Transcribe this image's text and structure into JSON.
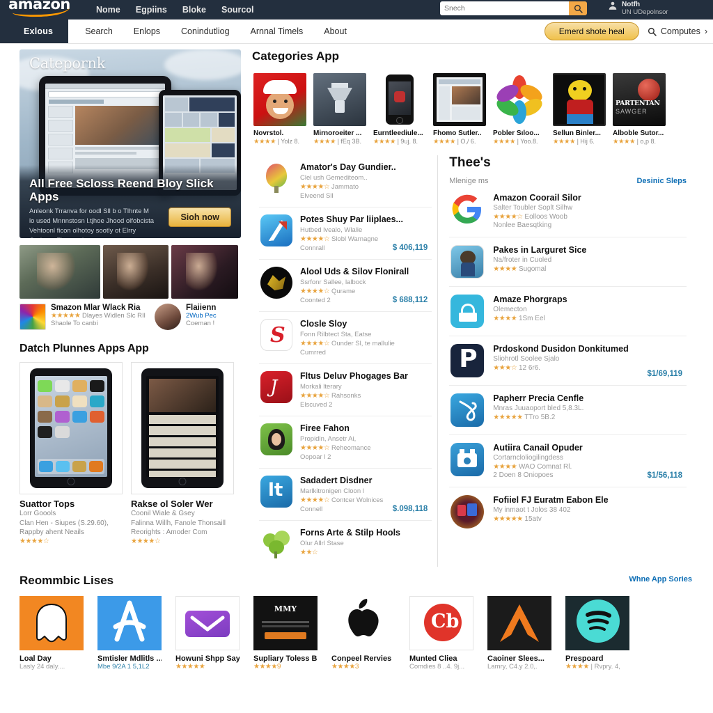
{
  "topnav": {
    "logo": "amazon",
    "links": [
      "Nome",
      "Egpiins",
      "Bloke",
      "Sourcol"
    ],
    "search_placeholder": "Snech",
    "search_icon": "search-icon",
    "account_line1": "Notfh",
    "account_line2": "UN UDepolnsor"
  },
  "subnav": {
    "brand": "Exlous",
    "links": [
      "Search",
      "Enlops",
      "Conindutliog",
      "Arnnal Timels",
      "About"
    ],
    "cta": "Emerd shote heal",
    "search_label": "Computes",
    "chevron": "›"
  },
  "hero": {
    "logo": "Catepornk",
    "title": "All Free Scloss Reend Bloy Slick Apps",
    "subtitle": "Anleonk Trranva for oodl Sll b o Tlhnte M lo used Mnnnstosn l.tjhoe Jhood olfobcista Vehtoonl ficon olhotoy sootly ot Elrry Gurboes Floceernl.",
    "cta": "Sioh now"
  },
  "left": {
    "mini_items": [
      {
        "title": "Smazon Mlar Wlack Ria",
        "line1": "Dlayes Widlen Slc RIl",
        "line2": "Shaole To canbi",
        "stars": "★★★★★"
      },
      {
        "title": "Flaiienn",
        "line1": "2Wub Pec",
        "line2": "Coeman !",
        "stars": ""
      }
    ],
    "section_title": "Datch Plunnes Apps App",
    "tablets": [
      {
        "title": "Suattor Tops",
        "sub1": "Lorr Goools",
        "sub2": "Clan Hen - Siupes (S.29.60), Rappby ahent Neails",
        "stars": "★★★★☆"
      },
      {
        "title": "Rakse ol Soler Wer",
        "sub1": "Coonil Wiale & Gsey",
        "sub2": "Falinna Willh, Fanole Thonsaill Reorights : Amoder Com",
        "stars": "★★★★☆"
      }
    ]
  },
  "categories": {
    "title": "Categories App",
    "apps": [
      {
        "label": "Novrstol.",
        "stars": "★★★★",
        "rate": "| Yolz 8.",
        "icon": "santa-character-icon"
      },
      {
        "label": "Mirnoroeiter ...",
        "stars": "★★★★",
        "rate": "| fEq 3B.",
        "icon": "lantern-icon"
      },
      {
        "label": "Eurntleediule...",
        "stars": "★★★★",
        "rate": "| 9uj. 8.",
        "icon": "phone-icon"
      },
      {
        "label": "Fhomo Sutler..",
        "stars": "★★★★",
        "rate": "| O,/ 6.",
        "icon": "tablet-screen-icon"
      },
      {
        "label": "Pobler Sıloo...",
        "stars": "★★★★",
        "rate": "| Yoo.8.",
        "icon": "flower-pinwheel-icon"
      },
      {
        "label": "Sellun Binler...",
        "stars": "★★★★",
        "rate": "| Hij 6.",
        "icon": "cartoon-face-icon"
      },
      {
        "label": "Alboble Sutor...",
        "stars": "★★★★",
        "rate": "| o,p 8.",
        "icon": "movie-poster-icon"
      }
    ]
  },
  "mid_list": [
    {
      "title": "Amator's Day Gundier..",
      "sub": "Clel ush Gemediteom..",
      "stars": "★★★★☆",
      "rate": "Jammato",
      "meta": "Elveend Sll",
      "price": "",
      "icon": "balloon-icon"
    },
    {
      "title": "Potes Shuy Par liiplaes...",
      "sub": "Hutbed lvealo, Wlalie",
      "stars": "★★★★☆",
      "rate": "Slobl Warnagne",
      "meta": "Connrall",
      "price": "$ 406,119",
      "icon": "compass-pen-icon"
    },
    {
      "title": "Alool Uds & Silov Flonirall",
      "sub": "Ssrfonr Sallee, lalbock",
      "stars": "★★★★☆",
      "rate": "Qurame",
      "meta": "Coonted 2",
      "price": "$ 688,112",
      "icon": "dragon-icon"
    },
    {
      "title": "Closle Sloy",
      "sub": "Fonn Rilbtect Sta, Eatse",
      "stars": "★★★★☆",
      "rate": "Ounder Sl, te mallulie",
      "meta": "Cumrred",
      "price": "",
      "icon": "red-s-icon"
    },
    {
      "title": "Fltus Deluv Phogages Bar",
      "sub": "Morkali lterary",
      "stars": "★★★★☆",
      "rate": "Rahsonks",
      "meta": "Elscuved 2",
      "price": "",
      "icon": "music-note-icon"
    },
    {
      "title": "Firee Fahon",
      "sub": "Propidln, Ansetr Ai,",
      "stars": "★★★★☆",
      "rate": "Reheomance",
      "meta": "Oopoar l 2",
      "price": "",
      "icon": "avatar-green-icon"
    },
    {
      "title": "Sadadert Disdner",
      "sub": "Marlkitronigen Cloon l",
      "stars": "★★★★☆",
      "rate": "Contcer Wolnices",
      "meta": "Connell",
      "price": "$.098,118",
      "icon": "blue-it-icon"
    },
    {
      "title": "Forns Arte & Stilp Hools",
      "sub": "Olur Allrl Stase",
      "stars": "★★☆",
      "rate": "",
      "meta": "",
      "price": "",
      "icon": "trees-icon"
    }
  ],
  "right": {
    "title": "Thee's",
    "subtitle": "Mlenige ms",
    "link": "Desinic Sleps",
    "items": [
      {
        "title": "Amazon Coorail Silor",
        "sub": "Salter Toubler Soplt Silhw",
        "stars": "★★★★☆",
        "rate": "Eolloos Woob",
        "meta": "Nonlee Baesqtking",
        "price": "",
        "icon": "google-g-icon"
      },
      {
        "title": "Pakes in Larguret Sice",
        "sub": "Na/froter in Cuoled",
        "stars": "★★★★",
        "rate": "Sugomal",
        "meta": "",
        "price": "",
        "icon": "game-character-icon"
      },
      {
        "title": "Amaze Phorgraps",
        "sub": "Olemecton",
        "stars": "★★★★",
        "rate": "1Sm Eel",
        "meta": "",
        "price": "",
        "icon": "lock-icon"
      },
      {
        "title": "Prdoskond Dusidon Donkitumed",
        "sub": "Sliohrotl Soolee Sjalo",
        "stars": "★★★☆",
        "rate": "12 6r6.",
        "meta": "",
        "price": "$1/69,119",
        "icon": "letter-p-icon"
      },
      {
        "title": "Papherr Precia Cenfle",
        "sub": "Mnras Juuaoport bled 5,8.3L.",
        "stars": "★★★★★",
        "rate": "TTro 5B.2",
        "meta": "",
        "price": "",
        "icon": "ribbon-icon"
      },
      {
        "title": "Autiira Canail Opuder",
        "sub": "Cortarncloliogilingdess",
        "stars": "★★★★",
        "rate": "WAO Comnat Rl.",
        "meta": "2 Doen 8 Oniopoes",
        "price": "$1/56,118",
        "icon": "camera-icon"
      },
      {
        "title": "Fofiiel FJ Euratm Eabon Ele",
        "sub": "My inmaot t Jolos 38 402",
        "stars": "★★★★★",
        "rate": "15atv",
        "meta": "",
        "price": "",
        "icon": "game-badge-icon"
      }
    ]
  },
  "bottom": {
    "title": "Reommbic Lises",
    "link": "Whne App Sories",
    "items": [
      {
        "title": "Loal Day",
        "sub": "Lasly 24 daly....",
        "stars": "",
        "icon": "ghost-icon",
        "color": "#f28722"
      },
      {
        "title": "Smtisler Mdlitls ...",
        "sub": "Mbe 9/2A 1 5,1L2",
        "stars": "",
        "icon": "app-store-a-icon",
        "color": "#3c9ae8"
      },
      {
        "title": "Howuni Shpp Say",
        "sub": "",
        "stars": "★★★★★",
        "icon": "envelope-icon",
        "color": "#ffffff"
      },
      {
        "title": "Supliary Toless Bay",
        "sub": "",
        "stars": "★★★★9",
        "icon": "movie-poster-dark-icon",
        "color": "#121212"
      },
      {
        "title": "Conpeel Rervies",
        "sub": "",
        "stars": "★★★★3",
        "icon": "apple-logo-icon",
        "color": "#ffffff"
      },
      {
        "title": "Munted Cliea",
        "sub": "Comdies 8 ..4. 9j...",
        "stars": "",
        "icon": "cb-circle-icon",
        "color": "#ffffff"
      },
      {
        "title": "Caoiner Slees...",
        "sub": "Lamry, C4.y 2.0,.",
        "stars": "",
        "icon": "orange-chevron-icon",
        "color": "#1b1b1b"
      },
      {
        "title": "Prespoard",
        "sub": "| Rvpry. 4,",
        "stars": "★★★★",
        "icon": "spotify-icon",
        "color": "#1b2b30"
      }
    ]
  },
  "colors": {
    "nav_dark": "#232f3e",
    "accent_orange": "#f3a847",
    "link_blue": "#0f6fb5",
    "price_blue": "#2a7fa8",
    "star_gold": "#e8a33d"
  }
}
